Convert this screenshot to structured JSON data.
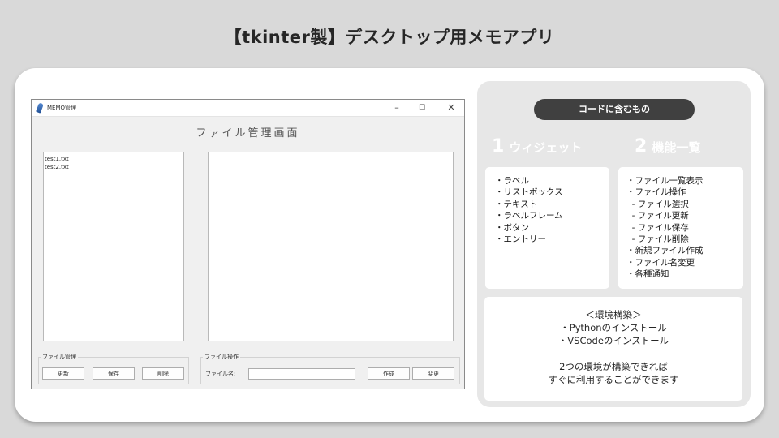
{
  "page": {
    "title": "【tkinter製】デスクトップ用メモアプリ"
  },
  "app_window": {
    "title": "MEMO管理",
    "controls": {
      "minimize": "–",
      "maximize": "☐",
      "close": "✕"
    },
    "heading": "ファイル管理画面",
    "file_list": [
      "test1.txt",
      "test2.txt"
    ],
    "file_frame": {
      "label": "ファイル管理",
      "buttons": [
        "更新",
        "保存",
        "削除"
      ]
    },
    "operation_frame": {
      "label": "ファイル操作",
      "filename_label": "ファイル名:",
      "filename_value": "",
      "buttons": [
        "作成",
        "変更"
      ]
    }
  },
  "panel": {
    "pill": "コードに含むもの",
    "section1": {
      "number": "1",
      "title": "ウィジェット"
    },
    "section2": {
      "number": "2",
      "title": "機能一覧"
    },
    "widgets": [
      "・ラベル",
      "・リストボックス",
      "・テキスト",
      "・ラベルフレーム",
      "・ボタン",
      "・エントリー"
    ],
    "features": [
      "・ファイル一覧表示",
      "・ファイル操作",
      "  - ファイル選択",
      "  - ファイル更新",
      "  - ファイル保存",
      "  - ファイル削除",
      "・新規ファイル作成",
      "・ファイル名変更",
      "・各種通知"
    ],
    "environment": [
      "＜環境構築＞",
      "・Pythonのインストール",
      "・VSCodeのインストール",
      "",
      "2つの環境が構築できれば",
      "すぐに利用することができます"
    ]
  }
}
